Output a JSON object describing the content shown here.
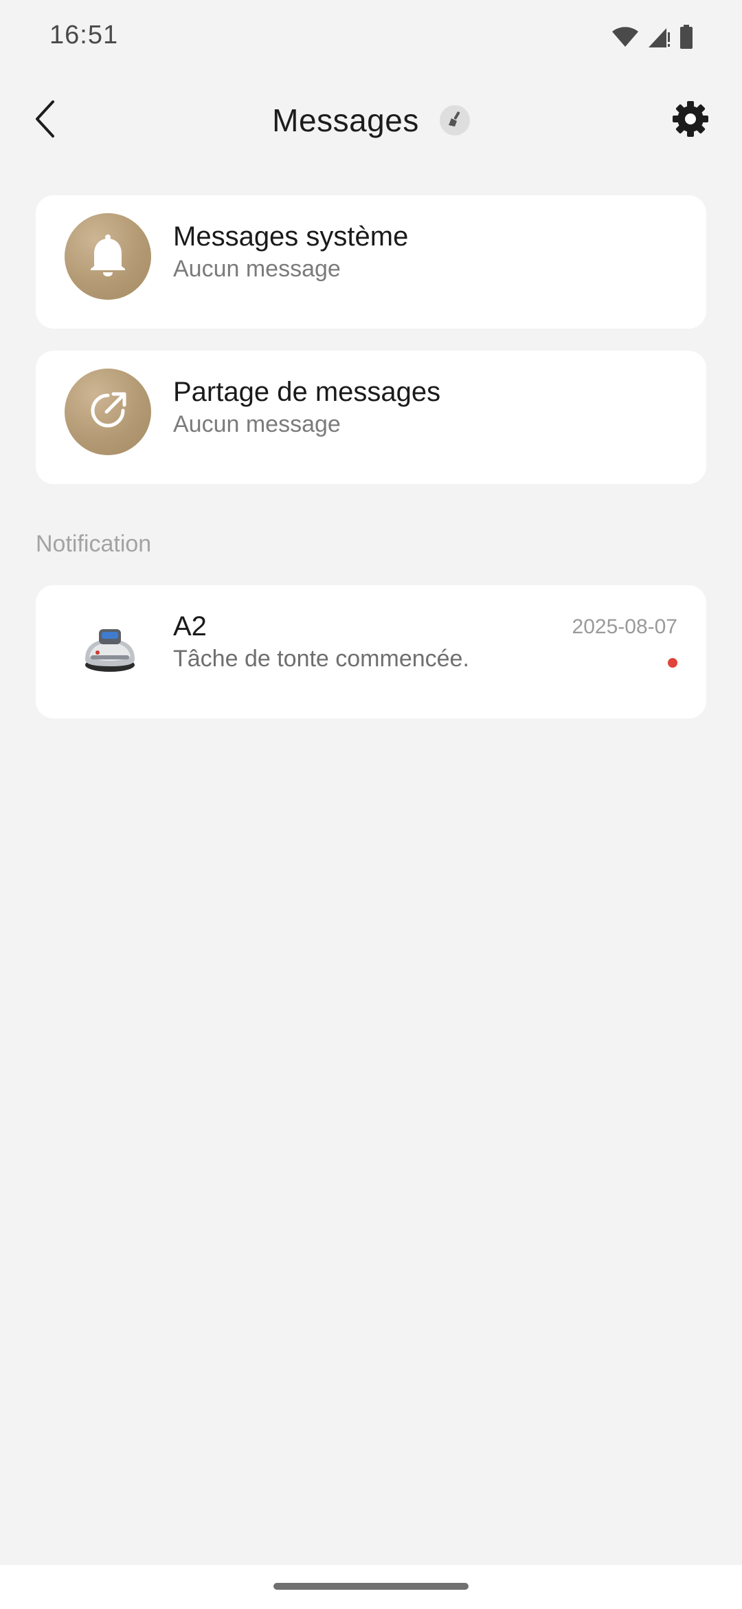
{
  "status_bar": {
    "time": "16:51",
    "icons": [
      "wifi-icon",
      "signal-icon",
      "battery-icon"
    ]
  },
  "header": {
    "title": "Messages",
    "back_icon": "chevron-left-icon",
    "clear_icon": "broom-icon",
    "settings_icon": "gear-icon"
  },
  "categories": [
    {
      "title": "Messages système",
      "subtitle": "Aucun message",
      "icon": "bell-icon"
    },
    {
      "title": "Partage de messages",
      "subtitle": "Aucun message",
      "icon": "share-icon"
    }
  ],
  "notification_section": {
    "label": "Notification",
    "items": [
      {
        "device": "A2",
        "text": "Tâche de tonte commencée.",
        "date": "2025-08-07",
        "unread": true,
        "icon": "robot-mower-icon"
      }
    ]
  },
  "colors": {
    "background": "#f3f3f3",
    "card": "#ffffff",
    "accent_gold": "#b39a74",
    "unread": "#e0443a"
  }
}
